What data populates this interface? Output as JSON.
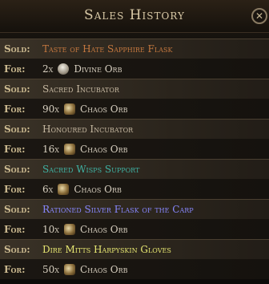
{
  "title": "Sales History",
  "close_glyph": "✕",
  "labels": {
    "sold": "Sold:",
    "for": "For:"
  },
  "colors": {
    "normal": "#c7b9a2",
    "unique": "#c5783f",
    "gem": "#3fb3a4",
    "magic": "#8888ff",
    "rare": "#e8e872"
  },
  "sales": [
    {
      "item": "Taste of Hate Sapphire Flask",
      "rarity": "unique",
      "qty": "2x",
      "currency": "Divine Orb",
      "icon": "divine-orb-icon"
    },
    {
      "item": "Sacred Incubator",
      "rarity": "normal",
      "qty": "90x",
      "currency": "Chaos Orb",
      "icon": "chaos-orb-icon"
    },
    {
      "item": "Honoured Incubator",
      "rarity": "normal",
      "qty": "16x",
      "currency": "Chaos Orb",
      "icon": "chaos-orb-icon"
    },
    {
      "item": "Sacred Wisps Support",
      "rarity": "gem",
      "qty": "6x",
      "currency": "Chaos Orb",
      "icon": "chaos-orb-icon"
    },
    {
      "item": "Rationed Silver Flask of the Carp",
      "rarity": "magic",
      "qty": "10x",
      "currency": "Chaos Orb",
      "icon": "chaos-orb-icon"
    },
    {
      "item": "Dire Mitts Harpyskin Gloves",
      "rarity": "rare",
      "qty": "50x",
      "currency": "Chaos Orb",
      "icon": "chaos-orb-icon"
    }
  ]
}
